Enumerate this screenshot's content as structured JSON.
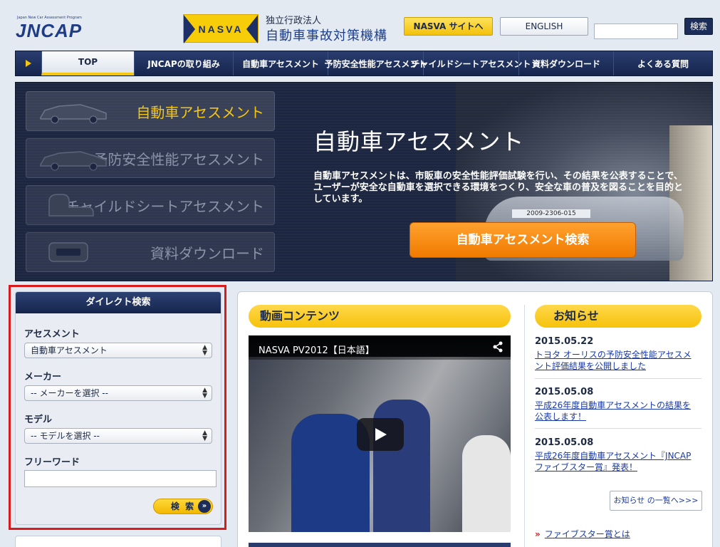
{
  "header": {
    "logo_small": "Japan New Car Assessment Program",
    "logo_text": "JNCAP",
    "nasva_logo": "NASVA",
    "org_sub": "独立行政法人",
    "org_name": "自動車事故対策機構",
    "nasva_site_label": "NASVA サイトへ",
    "english_label": "ENGLISH",
    "search_placeholder": "",
    "search_button": "検索"
  },
  "nav": {
    "items": [
      {
        "label": "TOP",
        "active": true
      },
      {
        "label": "JNCAPの取り組み"
      },
      {
        "label": "自動車アセスメント"
      },
      {
        "label": "予防安全性能アセスメント"
      },
      {
        "label": "チャイルドシートアセスメント"
      },
      {
        "label": "資料ダウンロード"
      },
      {
        "label": "よくある質問"
      }
    ]
  },
  "hero": {
    "tabs": [
      {
        "label": "自動車アセスメント",
        "icon": "car-icon",
        "active": true
      },
      {
        "label": "予防安全性能アセスメント",
        "icon": "car-sensor-icon"
      },
      {
        "label": "チャイルドシートアセスメント",
        "icon": "child-seat-icon"
      },
      {
        "label": "資料ダウンロード",
        "icon": "document-icon"
      }
    ],
    "title": "自動車アセスメント",
    "description": "自動車アセスメントは、市販車の安全性能評価試験を行い、その結果を公表することで、ユーザーが安全な自動車を選択できる環境をつくり、安全な車の普及を図ることを目的としています。",
    "plate": "2009-2306-015",
    "cta_label": "自動車アセスメント検索"
  },
  "direct_search": {
    "title": "ダイレクト検索",
    "assessment_label": "アセスメント",
    "assessment_value": "自動車アセスメント",
    "maker_label": "メーカー",
    "maker_value": "-- メーカーを選択 --",
    "model_label": "モデル",
    "model_value": "-- モデルを選択 --",
    "freeword_label": "フリーワード",
    "freeword_value": "",
    "search_button": "検 索"
  },
  "video_section": {
    "heading": "動画コンテンツ",
    "video_title": "NASVA PV2012【日本語】"
  },
  "news": {
    "heading": "お知らせ",
    "items": [
      {
        "date": "2015.05.22",
        "text": "トヨタ オーリスの予防安全性能アセスメント評価結果を公開しました"
      },
      {
        "date": "2015.05.08",
        "text": "平成26年度自動車アセスメントの結果を公表します！"
      },
      {
        "date": "2015.05.08",
        "text": "平成26年度自動車アセスメント『JNCAPファイブスター賞』発表！"
      }
    ],
    "more_label": "お知らせ の一覧へ>>>",
    "five_star_label": "ファイブスター賞とは"
  },
  "colors": {
    "navy": "#1c2d57",
    "accent_yellow": "#f6c510",
    "cta_orange": "#f07a00",
    "link_blue": "#1a3aa8",
    "highlight_red": "#d61c1c"
  }
}
